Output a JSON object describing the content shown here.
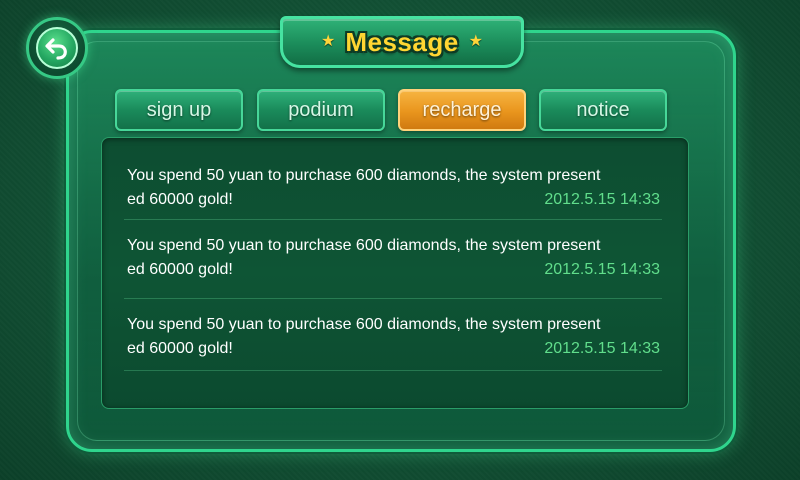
{
  "title": "Message",
  "tabs": [
    {
      "label": "sign up"
    },
    {
      "label": "podium"
    },
    {
      "label": "recharge",
      "active": true
    },
    {
      "label": "notice"
    }
  ],
  "messages": [
    {
      "line1": "You spend 50 yuan to purchase 600 diamonds, the system present",
      "line2": "ed 60000 gold!",
      "time": "2012.5.15 14:33"
    },
    {
      "line1": "You spend 50 yuan to purchase 600 diamonds, the system present",
      "line2": "ed 60000 gold!",
      "time": "2012.5.15 14:33"
    },
    {
      "line1": "You spend 50 yuan to purchase 600 diamonds, the system present",
      "line2": "ed 60000 gold!",
      "time": "2012.5.15 14:33"
    }
  ],
  "icons": {
    "back": "back-arrow-icon",
    "star": "star-icon"
  },
  "colors": {
    "accent_active_tab": "#e9951d",
    "timestamp": "#61de8c",
    "title": "#ffd632"
  }
}
